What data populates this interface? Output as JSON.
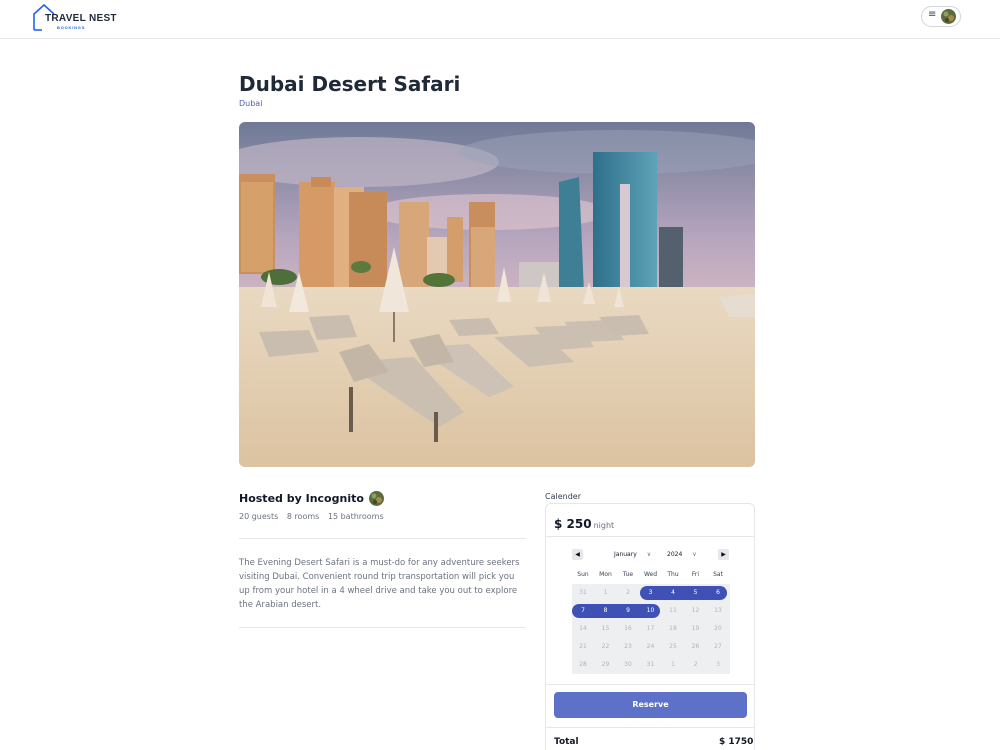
{
  "header": {
    "logo_text": "TRAVEL NEST",
    "logo_sub": "BOOKINGS",
    "menu_icon": "hamburger-icon",
    "avatar_icon": "avatar"
  },
  "listing": {
    "title": "Dubai Desert Safari",
    "location": "Dubai",
    "hero_image": "beach-resort-photo"
  },
  "host": {
    "label": "Hosted by Incognito",
    "guests": "20 guests",
    "rooms": "8 rooms",
    "bathrooms": "15 bathrooms"
  },
  "description": "The Evening Desert Safari is a must-do for any adventure seekers visiting Dubai. Convenient round trip transportation will pick you up from your hotel in a 4 wheel drive and take you out to explore the Arabian desert.",
  "booking": {
    "calendar_label": "Calender",
    "price": "$ 250",
    "price_unit": "night",
    "month": "January",
    "year": "2024",
    "days_of_week": [
      "Sun",
      "Mon",
      "Tue",
      "Wed",
      "Thu",
      "Fri",
      "Sat"
    ],
    "weeks": [
      [
        "31",
        "1",
        "2",
        "3",
        "4",
        "5",
        "6"
      ],
      [
        "7",
        "8",
        "9",
        "10",
        "11",
        "12",
        "13"
      ],
      [
        "14",
        "15",
        "16",
        "17",
        "18",
        "19",
        "20"
      ],
      [
        "21",
        "22",
        "23",
        "24",
        "25",
        "26",
        "27"
      ],
      [
        "28",
        "29",
        "30",
        "31",
        "1",
        "2",
        "3"
      ]
    ],
    "selected_dates": [
      "3",
      "4",
      "5",
      "6",
      "7",
      "8",
      "9",
      "10"
    ],
    "reserve_label": "Reserve",
    "total_label": "Total",
    "total_value": "$ 1750"
  },
  "colors": {
    "accent": "#3f51b5",
    "button": "#5e71c9",
    "location_link": "#4f5fb3"
  }
}
